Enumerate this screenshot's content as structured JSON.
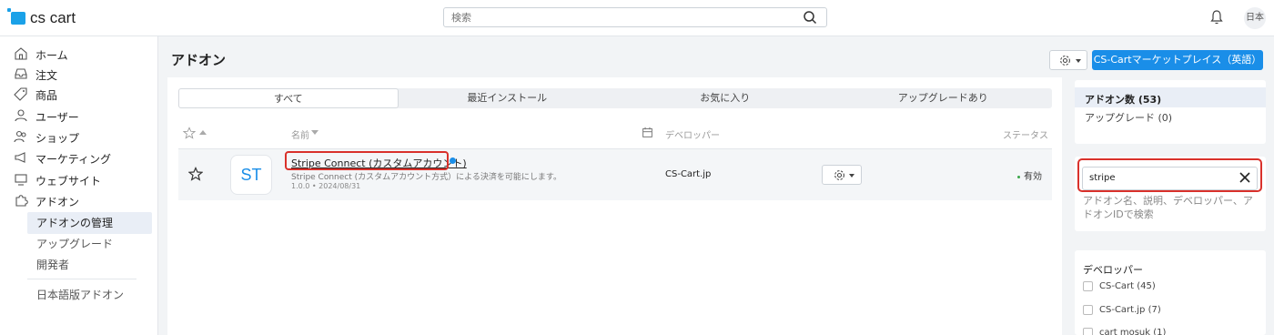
{
  "header": {
    "logo_text": "cs cart",
    "search_placeholder": "検索",
    "language_badge": "日本"
  },
  "sidebar": {
    "items": [
      {
        "label": "ホーム",
        "icon": "home-icon"
      },
      {
        "label": "注文",
        "icon": "inbox-icon"
      },
      {
        "label": "商品",
        "icon": "tag-icon"
      },
      {
        "label": "ユーザー",
        "icon": "user-icon"
      },
      {
        "label": "ショップ",
        "icon": "users-icon"
      },
      {
        "label": "マーケティング",
        "icon": "megaphone-icon"
      },
      {
        "label": "ウェブサイト",
        "icon": "monitor-icon"
      },
      {
        "label": "アドオン",
        "icon": "puzzle-icon"
      }
    ],
    "sub_items": [
      {
        "label": "アドオンの管理",
        "active": true
      },
      {
        "label": "アップグレード",
        "active": false
      },
      {
        "label": "開発者",
        "active": false
      }
    ],
    "extra_item": "日本語版アドオン"
  },
  "page": {
    "title": "アドオン",
    "marketplace_button": "CS-Cartマーケットプレイス（英語）"
  },
  "tabs": [
    "すべて",
    "最近インストール",
    "お気に入り",
    "アップグレードあり"
  ],
  "table": {
    "headers": {
      "name": "名前",
      "developer": "デベロッパー",
      "status": "ステータス"
    },
    "rows": [
      {
        "icon_text": "ST",
        "name": "Stripe Connect (カスタムアカウント)",
        "description": "Stripe Connect (カスタムアカウント方式）による決済を可能にします。",
        "version": "1.0.0 • 2024/08/31",
        "developer": "CS-Cart.jp",
        "status": "有効"
      }
    ]
  },
  "right_panel": {
    "count_label": "アドオン数 (53)",
    "upgrade_label": "アップグレード (0)",
    "filter_value": "stripe",
    "filter_hint": "アドオン名、説明、デベロッパー、アドオンIDで検索",
    "developer_title": "デベロッパー",
    "developers": [
      "CS-Cart (45)",
      "CS-Cart.jp (7)",
      "cart mosuk (1)"
    ]
  },
  "colors": {
    "accent": "#1a8ee8",
    "highlight": "#d9312b",
    "active_bg": "#e9eef6"
  }
}
